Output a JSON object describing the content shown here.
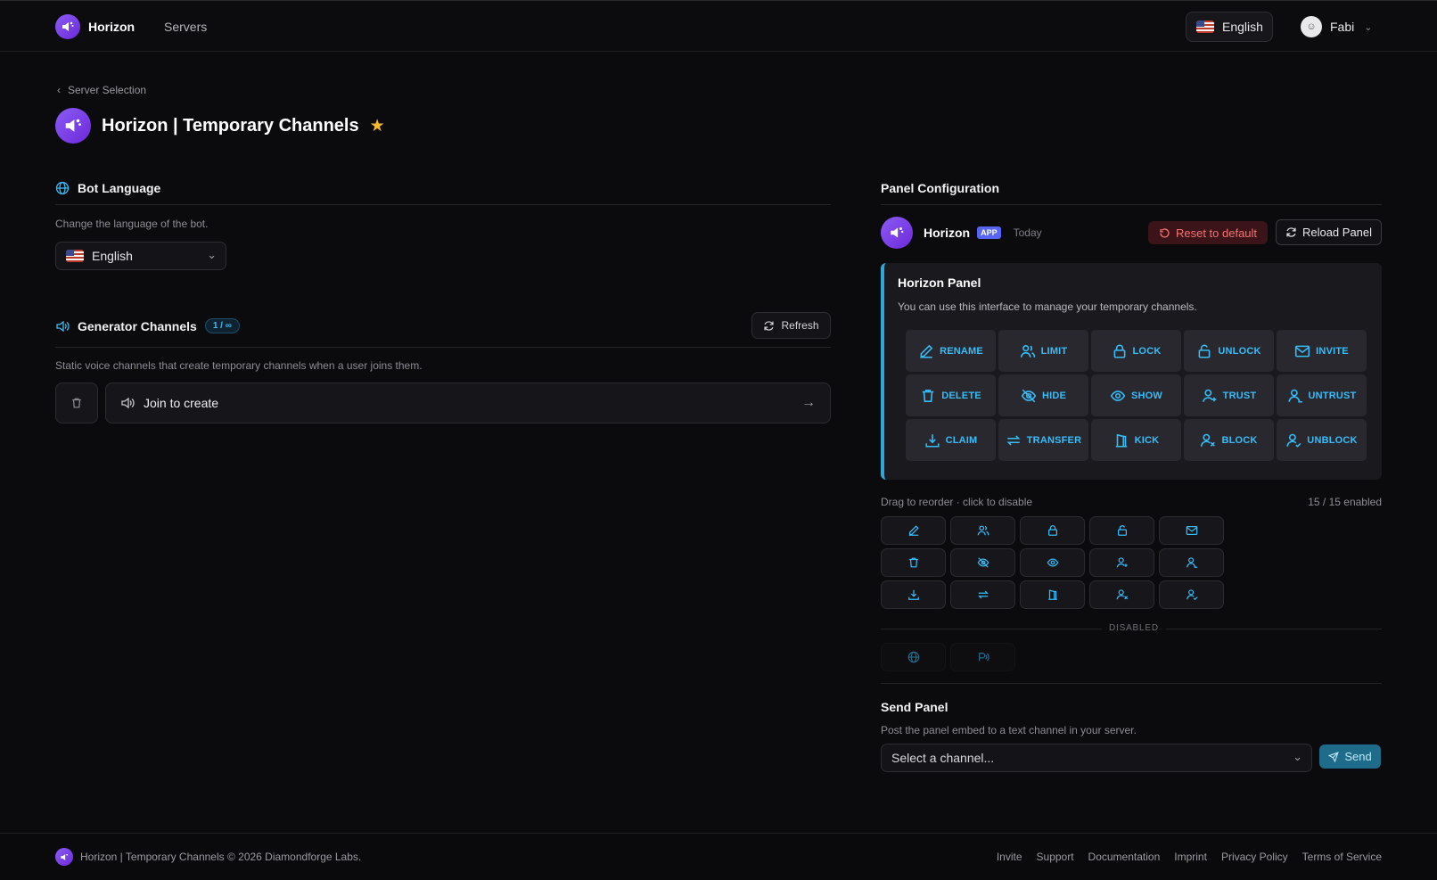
{
  "header": {
    "brand": "Horizon",
    "nav_servers": "Servers",
    "language": "English",
    "user_name": "Fabi"
  },
  "breadcrumb": "Server Selection",
  "page_title": "Horizon | Temporary Channels",
  "bot_language": {
    "title": "Bot Language",
    "description": "Change the language of the bot.",
    "selected": "English"
  },
  "generator": {
    "title": "Generator Channels",
    "count": "1 / ∞",
    "refresh_label": "Refresh",
    "description": "Static voice channels that create temporary channels when a user joins them.",
    "channels": [
      "Join to create"
    ]
  },
  "panel_config": {
    "title": "Panel Configuration",
    "bot_name": "Horizon",
    "app_tag": "APP",
    "timestamp": "Today",
    "reset_label": "Reset to default",
    "reload_label": "Reload Panel",
    "embed_title": "Horizon Panel",
    "embed_description": "You can use this interface to manage your temporary channels.",
    "actions": [
      {
        "label": "RENAME",
        "icon": "pencil-icon"
      },
      {
        "label": "LIMIT",
        "icon": "users-icon"
      },
      {
        "label": "LOCK",
        "icon": "lock-icon"
      },
      {
        "label": "UNLOCK",
        "icon": "unlock-icon"
      },
      {
        "label": "INVITE",
        "icon": "mail-icon"
      },
      {
        "label": "DELETE",
        "icon": "trash-icon"
      },
      {
        "label": "HIDE",
        "icon": "eye-off-icon"
      },
      {
        "label": "SHOW",
        "icon": "eye-icon"
      },
      {
        "label": "TRUST",
        "icon": "user-plus-icon"
      },
      {
        "label": "UNTRUST",
        "icon": "user-icon"
      },
      {
        "label": "CLAIM",
        "icon": "download-icon"
      },
      {
        "label": "TRANSFER",
        "icon": "transfer-icon"
      },
      {
        "label": "KICK",
        "icon": "door-icon"
      },
      {
        "label": "BLOCK",
        "icon": "user-x-icon"
      },
      {
        "label": "UNBLOCK",
        "icon": "user-check-icon"
      }
    ],
    "drag_hint": "Drag to reorder · click to disable",
    "enabled_count": "15 / 15 enabled",
    "disabled_label": "DISABLED",
    "disabled_icons": [
      "globe-icon",
      "voice-region-icon"
    ]
  },
  "send_panel": {
    "title": "Send Panel",
    "description": "Post the panel embed to a text channel in your server.",
    "select_placeholder": "Select a channel...",
    "send_label": "Send"
  },
  "footer": {
    "copyright": "Horizon | Temporary Channels © 2026 Diamondforge Labs.",
    "links": [
      "Invite",
      "Support",
      "Documentation",
      "Imprint",
      "Privacy Policy",
      "Terms of Service"
    ]
  },
  "colors": {
    "accent": "#38bdf8",
    "brand": "#7c3aed",
    "danger": "#f87171",
    "background": "#0b0b0d"
  }
}
